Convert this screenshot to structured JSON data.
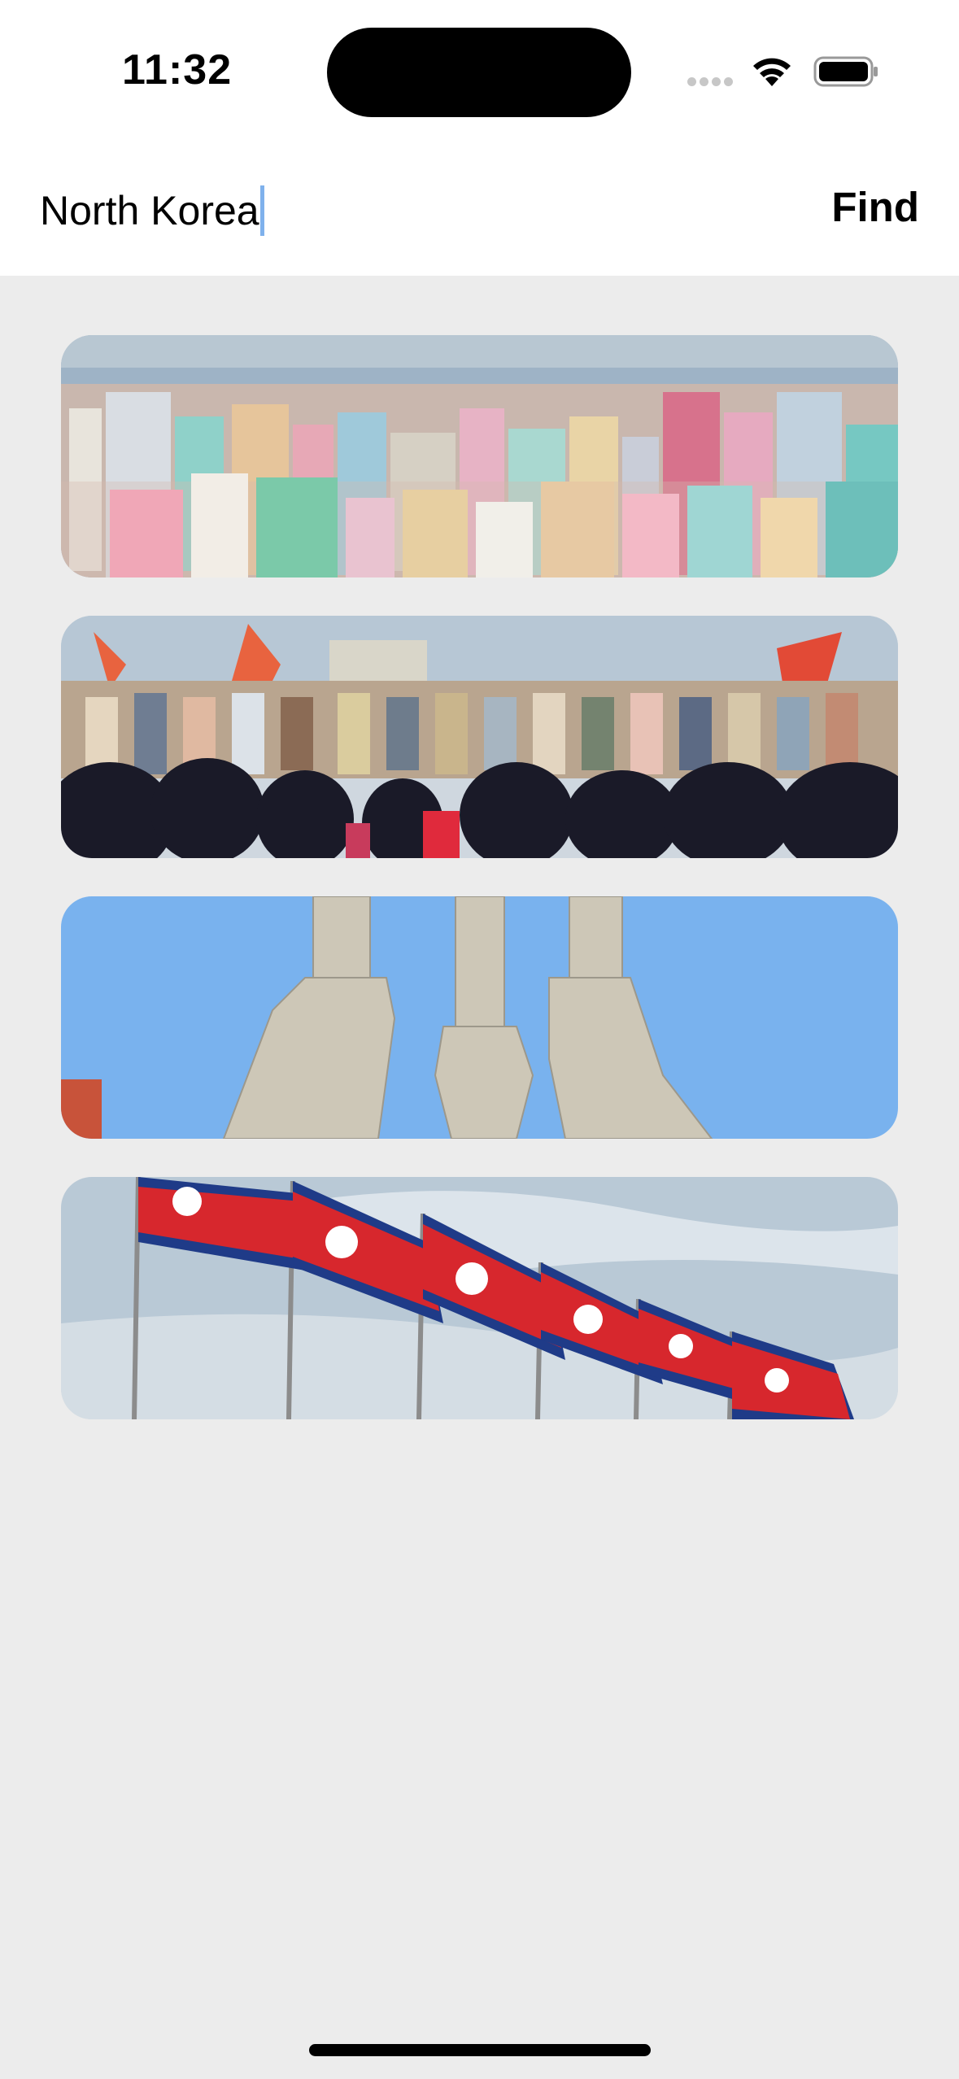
{
  "status_bar": {
    "time": "11:32",
    "icons": [
      "cellular-signal-icon",
      "wifi-icon",
      "battery-icon"
    ]
  },
  "search": {
    "query": "North Korea",
    "button_label": "Find",
    "caret_color": "#7fb1ec"
  },
  "results": [
    {
      "subject": "city-skyline",
      "icon": "pyongyang-skyline-image"
    },
    {
      "subject": "mural-crowd",
      "icon": "mural-crowd-image"
    },
    {
      "subject": "monument",
      "icon": "party-monument-image"
    },
    {
      "subject": "flags",
      "icon": "flags-image"
    }
  ],
  "colors": {
    "background": "#ececec",
    "header_background": "#ffffff"
  }
}
